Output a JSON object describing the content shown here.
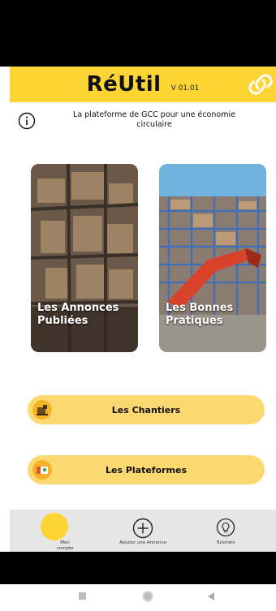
{
  "header": {
    "title": "RéUtil",
    "version": "V 01.01",
    "link_icon": "link-icon",
    "background": "#fcd535"
  },
  "info": {
    "icon": "info-icon",
    "tagline_line1": "La plateforme de GCC pour une économie",
    "tagline_line2": "circulaire"
  },
  "cards": [
    {
      "label_line1": "Les Annonces",
      "label_line2": "Publiées"
    },
    {
      "label_line1": "Les Bonnes",
      "label_line2": "Pratiques"
    }
  ],
  "buttons": {
    "chantiers": {
      "label": "Les Chantiers",
      "icon": "construction-icon"
    },
    "plateformes": {
      "label": "Les Plateformes",
      "icon": "platform-icon"
    }
  },
  "tabbar": {
    "account_line1": "Mon",
    "account_line2": "compte",
    "add_label": "Ajouter une Annonce",
    "tutorials_label": "Tutoriels"
  },
  "colors": {
    "accent": "#fcd535",
    "pill": "#fcd970"
  }
}
